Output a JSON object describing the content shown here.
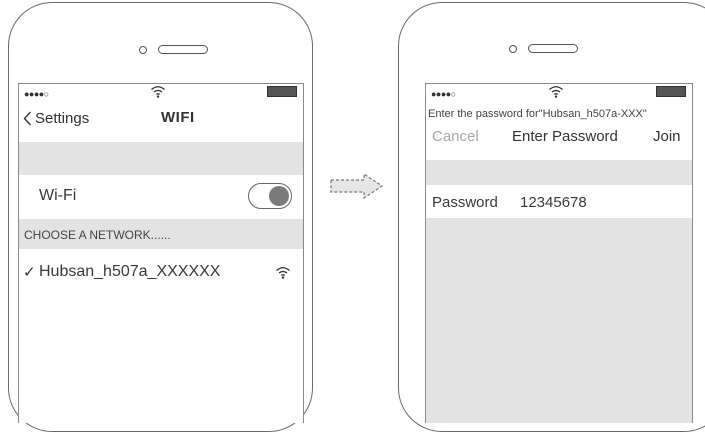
{
  "left_screen": {
    "status": {
      "signal": "●●●●○"
    },
    "nav": {
      "back_label": "Settings",
      "title": "WIFI"
    },
    "wifi_row": {
      "label": "Wi-Fi",
      "toggle_on": true
    },
    "section_header": "CHOOSE A NETWORK......",
    "network": {
      "check": "✓",
      "name": "Hubsan_h507a_XXXXXX"
    }
  },
  "right_screen": {
    "status": {
      "signal": "●●●●○"
    },
    "prompt": "Enter the password for\"Hubsan_h507a-XXX\"",
    "nav": {
      "cancel_label": "Cancel",
      "title": "Enter Password",
      "join_label": "Join"
    },
    "password_row": {
      "label": "Password",
      "value": "12345678"
    }
  },
  "arrow": {
    "icon": "dashed-right-arrow-icon"
  },
  "colors": {
    "band": "#e3e3e3",
    "outline": "#6a6a6a",
    "text": "#3a3a3a",
    "muted": "#9a9a9a"
  }
}
